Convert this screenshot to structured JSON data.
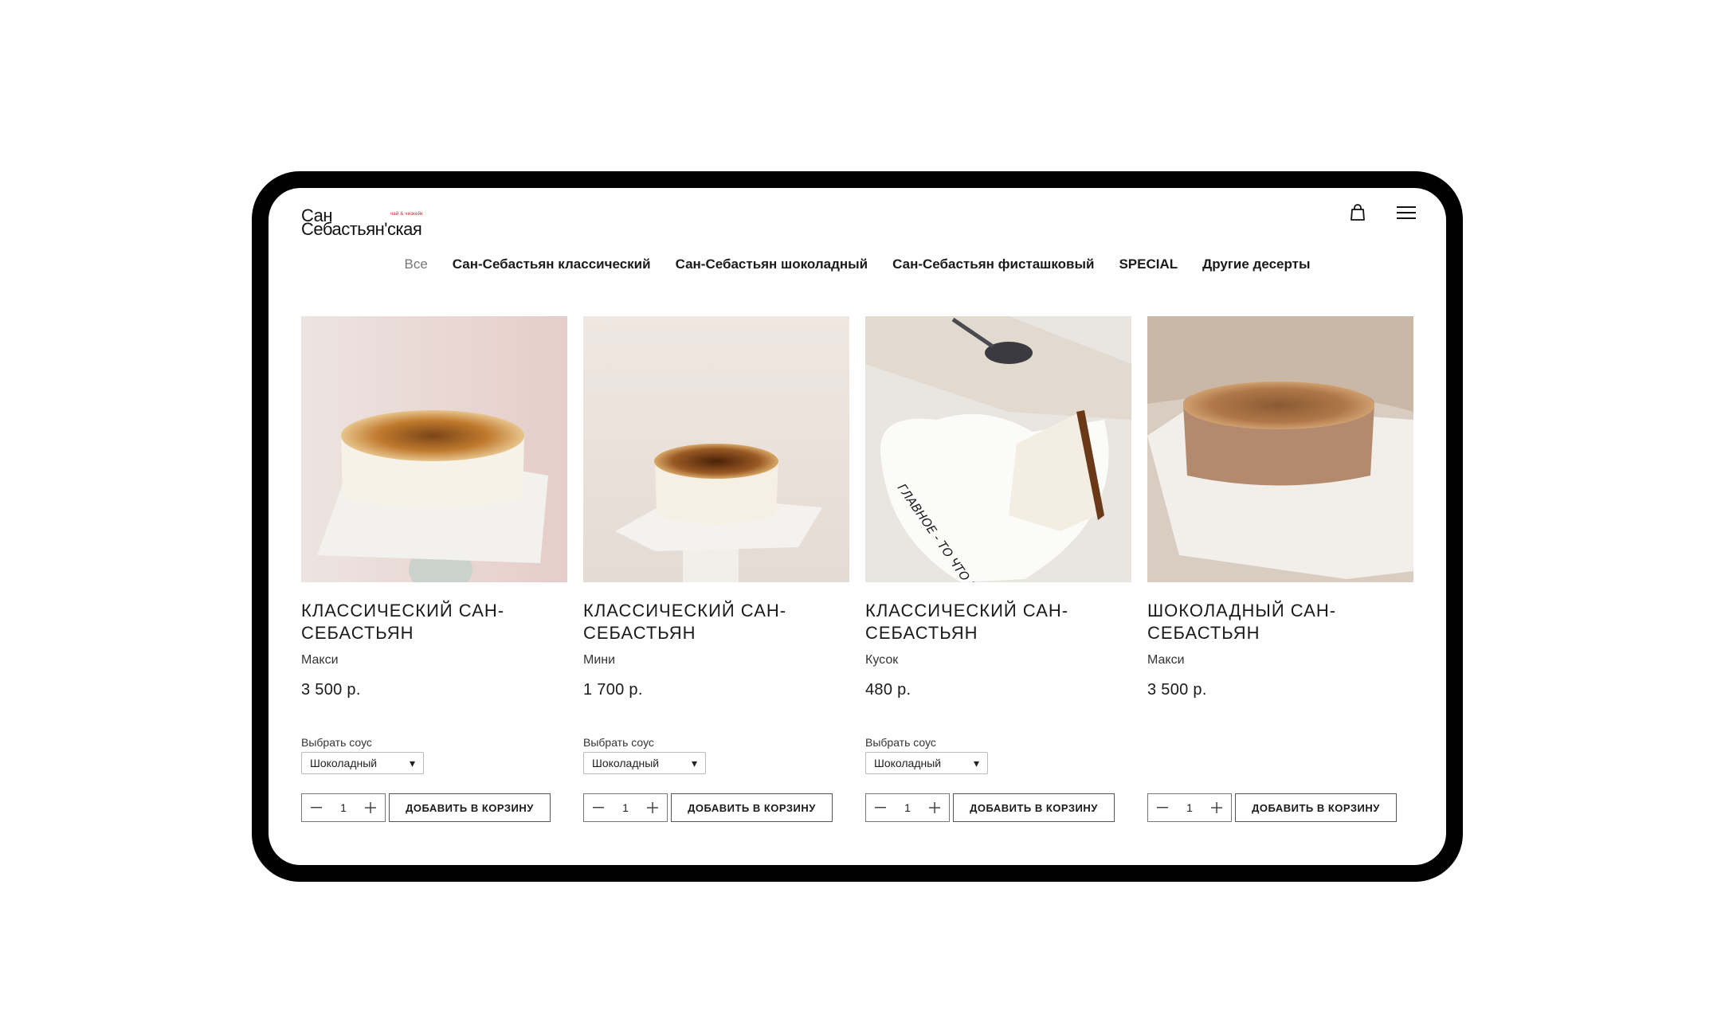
{
  "brand": {
    "logo_line1": "Сан",
    "logo_line2": "Себастьян'ская",
    "logo_tagline": "чай & чизкейк",
    "accent_color": "#d0182a"
  },
  "header": {
    "icons": [
      "shopping-bag-icon",
      "hamburger-menu-icon"
    ]
  },
  "categories": [
    {
      "label": "Все",
      "active": true
    },
    {
      "label": "Сан-Себастьян классический",
      "active": false
    },
    {
      "label": "Сан-Себастьян шоколадный",
      "active": false
    },
    {
      "label": "Сан-Себастьян фисташковый",
      "active": false
    },
    {
      "label": "SPECIAL",
      "active": false
    },
    {
      "label": "Другие десерты",
      "active": false
    }
  ],
  "products": [
    {
      "title": "Классический Сан-Себастьян",
      "variant": "Макси",
      "price": "3 500 р.",
      "sauce_label": "Выбрать соус",
      "sauce_value": "Шоколадный",
      "qty": "1",
      "add_label": "ДОБАВИТЬ В КОРЗИНУ"
    },
    {
      "title": "Классический Сан-Себастьян",
      "variant": "Мини",
      "price": "1 700 р.",
      "sauce_label": "Выбрать соус",
      "sauce_value": "Шоколадный",
      "qty": "1",
      "add_label": "ДОБАВИТЬ В КОРЗИНУ"
    },
    {
      "title": "Классический Сан-Себастьян",
      "variant": "Кусок",
      "price": "480 р.",
      "sauce_label": "Выбрать соус",
      "sauce_value": "Шоколадный",
      "qty": "1",
      "add_label": "ДОБАВИТЬ В КОРЗИНУ",
      "plate_text": "ГЛАВНОЕ - ТО ЧТО ВНУТРИ"
    },
    {
      "title": "Шоколадный Сан-Себастьян",
      "variant": "Макси",
      "price": "3 500 р.",
      "qty": "1",
      "add_label": "ДОБАВИТЬ В КОРЗИНУ"
    }
  ]
}
